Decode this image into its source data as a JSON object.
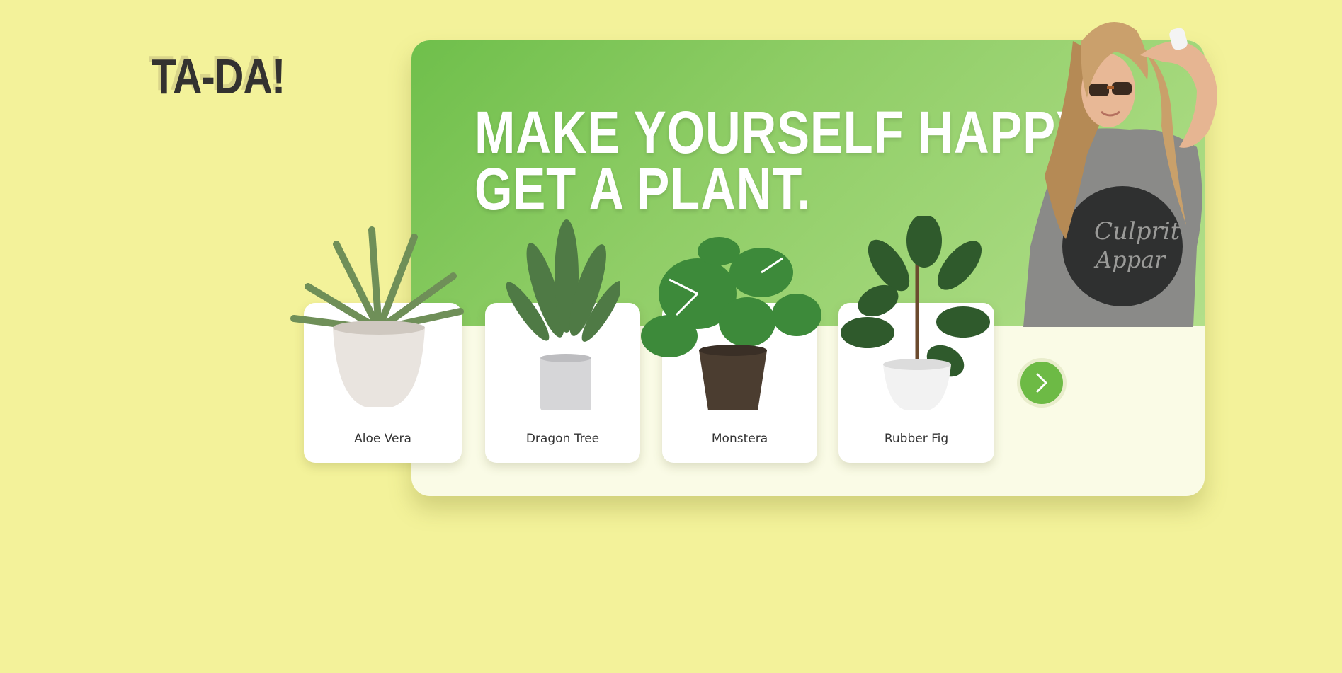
{
  "brand": {
    "logo": "TA-DA!"
  },
  "hero": {
    "headline_line1": "MAKE YOURSELF HAPPY.",
    "headline_line2": "GET A PLANT.",
    "banner_gradient": [
      "#6fbf4b",
      "#b2df8a"
    ],
    "model_shirt_text": "Culprit Apparel"
  },
  "plants": [
    {
      "name": "Aloe Vera",
      "icon": "aloe-vera-plant"
    },
    {
      "name": "Dragon Tree",
      "icon": "dragon-tree-plant"
    },
    {
      "name": "Monstera",
      "icon": "monstera-plant"
    },
    {
      "name": "Rubber Fig",
      "icon": "rubber-fig-plant"
    }
  ],
  "controls": {
    "next_icon": "chevron-right-icon",
    "accent": "#6dba45"
  },
  "colors": {
    "page_bg": "#f3f29a",
    "card_bg": "#ffffff",
    "panel_bg": "#fafbe6"
  }
}
